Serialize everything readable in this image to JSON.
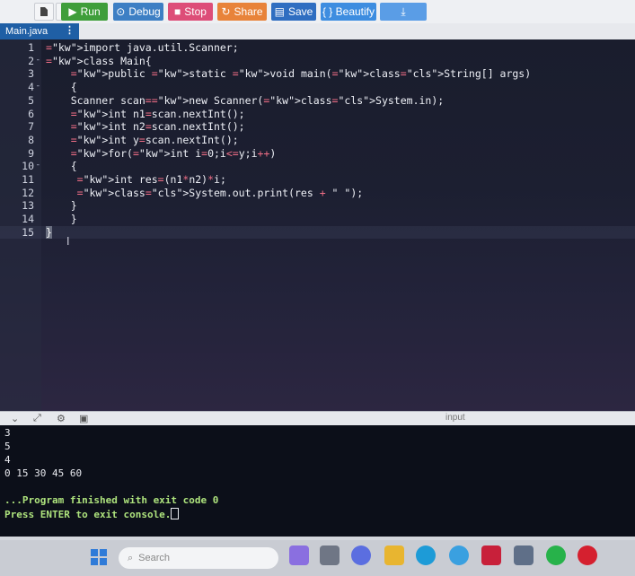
{
  "toolbar": {
    "run_label": "Run",
    "debug_label": "Debug",
    "stop_label": "Stop",
    "share_label": "Share",
    "save_label": "Save",
    "beautify_label": "{ } Beautify",
    "run_color": "#3f9e3b",
    "debug_color": "#3d7fc4",
    "stop_color": "#dd4d78",
    "share_color": "#e8833a",
    "save_color": "#2f6ec1",
    "beautify_color": "#3d8de0",
    "download_color": "#5a9de6"
  },
  "tabs": [
    {
      "label": "Main.java"
    }
  ],
  "editor": {
    "lines": [
      {
        "n": "1",
        "t": "import java.util.Scanner;"
      },
      {
        "n": "2",
        "t": "class Main{"
      },
      {
        "n": "3",
        "t": "    public static void main(String[] args)"
      },
      {
        "n": "4",
        "t": "    {"
      },
      {
        "n": "5",
        "t": "    Scanner scan=new Scanner(System.in);"
      },
      {
        "n": "6",
        "t": "    int n1=scan.nextInt();"
      },
      {
        "n": "7",
        "t": "    int n2=scan.nextInt();"
      },
      {
        "n": "8",
        "t": "    int y=scan.nextInt();"
      },
      {
        "n": "9",
        "t": "    for(int i=0;i<=y;i++)"
      },
      {
        "n": "10",
        "t": "    {"
      },
      {
        "n": "11",
        "t": "     int res=(n1*n2)*i;"
      },
      {
        "n": "12",
        "t": "     System.out.print(res + \" \");"
      },
      {
        "n": "13",
        "t": "    }"
      },
      {
        "n": "14",
        "t": "    }"
      },
      {
        "n": "15",
        "t": "}"
      }
    ]
  },
  "console": {
    "input_label": "input",
    "lines": [
      "3",
      "5",
      "4",
      "0 15 30 45 60",
      "",
      "...Program finished with exit code 0",
      "Press ENTER to exit console."
    ]
  },
  "taskbar": {
    "search_placeholder": "Search"
  }
}
